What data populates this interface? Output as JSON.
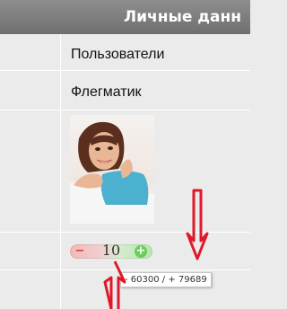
{
  "header": {
    "title": "Личные данн"
  },
  "profile": {
    "username": "Пользователи",
    "status": "Флегматик",
    "photo_alt": "user-photo"
  },
  "rating": {
    "minus_label": "−",
    "score": "10",
    "plus_label": "+",
    "tooltip": "- 60300 / + 79689"
  },
  "colors": {
    "header": "#7a7a7a",
    "table_bg": "#ebebeb",
    "annotation_arrow": "#e0192a",
    "minus_color": "#d63b3b",
    "plus_color": "#6bcf57"
  }
}
